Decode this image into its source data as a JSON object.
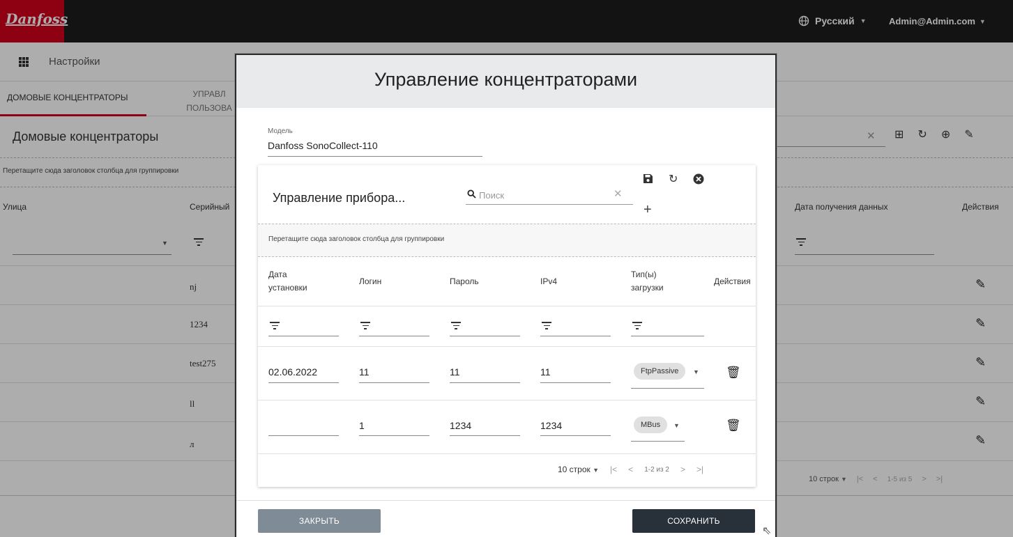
{
  "topbar": {
    "logo_text": "Danfoss",
    "language": "Русский",
    "user": "Admin@Admin.com"
  },
  "appbar": {
    "title": "Настройки"
  },
  "tabs": [
    {
      "label": "ДОМОВЫЕ КОНЦЕНТРАТОРЫ"
    },
    {
      "label": "УПРАВЛ\nПОЛЬЗОВА"
    }
  ],
  "section": {
    "title": "Домовые концентраторы",
    "group_hint": "Перетащите сюда заголовок столбца для группировки",
    "headers": {
      "street": "Улица",
      "serial": "Серийный",
      "data_date": "Дата получения данных",
      "actions": "Действия"
    },
    "rows": [
      {
        "serial": "nj"
      },
      {
        "serial": "1234"
      },
      {
        "serial": "test275"
      },
      {
        "serial": "ll"
      },
      {
        "serial": "л"
      }
    ],
    "pager": {
      "rows_per_page": "10 строк",
      "range": "1-5 из 5"
    }
  },
  "dialog": {
    "title": "Управление концентраторами",
    "model": {
      "label": "Модель",
      "value": "Danfoss SonoCollect-110"
    },
    "devices": {
      "title": "Управление прибора...",
      "search_placeholder": "Поиск",
      "group_hint": "Перетащите сюда заголовок столбца для группировки",
      "columns": [
        "Дата\nустановки",
        "Логин",
        "Пароль",
        "IPv4",
        "Тип(ы)\nзагрузки",
        "Действия"
      ],
      "rows": [
        {
          "date": "02.06.2022",
          "login": "11",
          "password": "11",
          "ipv4": "11",
          "type": "FtpPassive"
        },
        {
          "date": "",
          "login": "1",
          "password": "1234",
          "ipv4": "1234",
          "type": "MBus"
        }
      ],
      "pager": {
        "rows_per_page": "10 строк",
        "range": "1-2 из 2"
      }
    },
    "buttons": {
      "close": "ЗАКРЫТЬ",
      "save": "СОХРАНИТЬ"
    }
  },
  "icons": [
    "globe-icon",
    "apps-grid-icon",
    "search-icon",
    "clear-icon",
    "save-icon",
    "refresh-icon",
    "cancel-icon",
    "add-icon",
    "filter-icon",
    "delete-icon",
    "edit-icon",
    "add-box-icon",
    "add-circle-icon"
  ],
  "colors": {
    "brand": "#d0021b",
    "topbar": "#1d1d1d",
    "save_button": "#283039",
    "close_button": "#7f8b96"
  }
}
